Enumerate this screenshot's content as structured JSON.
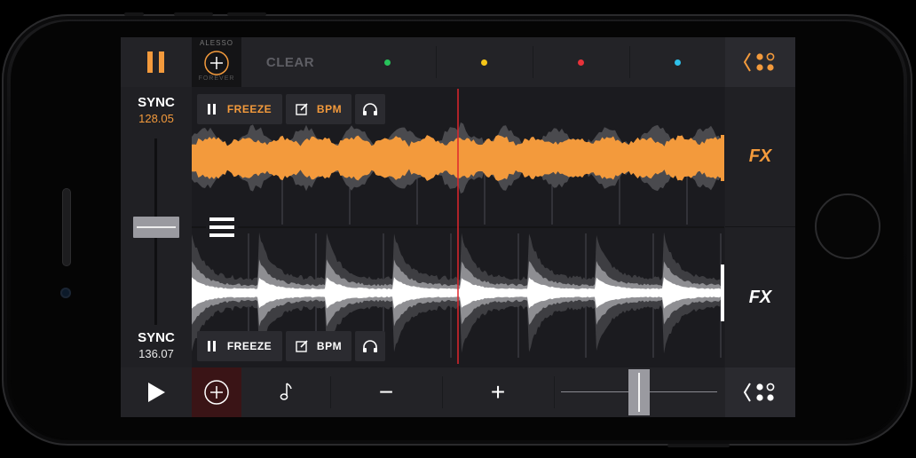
{
  "top_bar": {
    "clear_label": "CLEAR",
    "album_top_text": "ALESSO",
    "album_bottom_text": "FOREVER",
    "cue_colors": [
      "#27c25a",
      "#f5c518",
      "#e8323a",
      "#2ec0ea"
    ]
  },
  "deck_a": {
    "sync_label": "SYNC",
    "bpm": "128.05",
    "freeze_label": "FREEZE",
    "bpm_button_label": "BPM",
    "fx_label": "FX",
    "color": "#f39a3c"
  },
  "deck_b": {
    "sync_label": "SYNC",
    "bpm": "136.07",
    "freeze_label": "FREEZE",
    "bpm_button_label": "BPM",
    "fx_label": "FX",
    "color": "#ffffff"
  },
  "bottom_bar": {
    "minus_label": "−",
    "plus_label": "+"
  },
  "icons": {
    "pause": "pause-icon",
    "play": "play-icon",
    "add": "plus-circle-icon",
    "note": "music-note-icon",
    "menu": "hamburger-icon",
    "headphones": "headphones-icon",
    "edit": "edit-icon",
    "chevron": "chevron-left-icon",
    "dots": "dots-grid-icon"
  }
}
